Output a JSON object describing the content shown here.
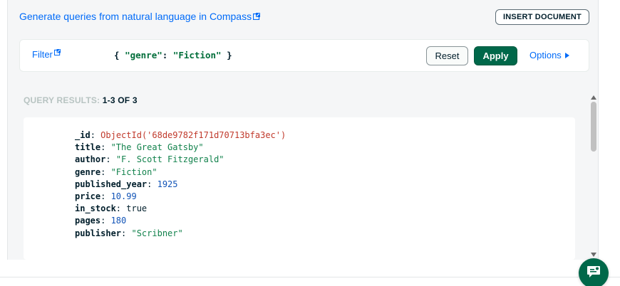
{
  "header": {
    "generate_link": "Generate queries from natural language in Compass",
    "insert_button": "INSERT DOCUMENT"
  },
  "filter": {
    "label": "Filter",
    "query": {
      "open": "{ ",
      "key": "\"genre\"",
      "colon": ": ",
      "value": "\"Fiction\"",
      "close": " }"
    },
    "reset_label": "Reset",
    "apply_label": "Apply",
    "options_label": "Options"
  },
  "results": {
    "prefix": "QUERY RESULTS: ",
    "count": "1-3 OF 3"
  },
  "document": {
    "fields": [
      {
        "key": "_id",
        "value": "ObjectId('68de9782f171d70713bfa3ec')",
        "type": "oid"
      },
      {
        "key": "title",
        "value": "\"The Great Gatsby\"",
        "type": "str"
      },
      {
        "key": "author",
        "value": "\"F. Scott Fitzgerald\"",
        "type": "str"
      },
      {
        "key": "genre",
        "value": "\"Fiction\"",
        "type": "str"
      },
      {
        "key": "published_year",
        "value": "1925",
        "type": "num"
      },
      {
        "key": "price",
        "value": "10.99",
        "type": "num"
      },
      {
        "key": "in_stock",
        "value": "true",
        "type": "bool"
      },
      {
        "key": "pages",
        "value": "180",
        "type": "num"
      },
      {
        "key": "publisher",
        "value": "\"Scribner\"",
        "type": "str"
      }
    ]
  },
  "icons": {
    "external_link": "external-link-icon",
    "options_caret": "caret-right-icon",
    "scroll_up": "scroll-up-arrow-icon",
    "scroll_down": "scroll-down-arrow-icon",
    "chat": "chat-bubble-icon"
  },
  "colors": {
    "link": "#016bf8",
    "apply_bg": "#00684a",
    "string_value": "#12824c",
    "number_value": "#1254b7",
    "objectid_value": "#c0392b"
  }
}
